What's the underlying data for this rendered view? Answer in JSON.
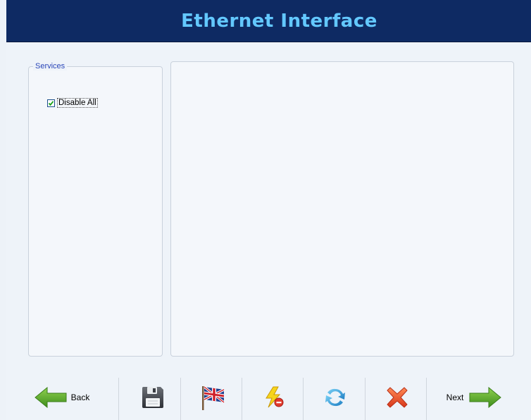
{
  "header": {
    "title": "Ethernet Interface"
  },
  "services": {
    "legend": "Services",
    "disable_all": {
      "label": "Disable All",
      "checked": true
    }
  },
  "toolbar": {
    "back_label": "Back",
    "next_label": "Next",
    "icons": [
      "back-arrow-icon",
      "save-icon",
      "language-flag-icon",
      "alert-icon",
      "refresh-icon",
      "cancel-icon",
      "next-arrow-icon"
    ]
  },
  "colors": {
    "header_bg": "#0e2a63",
    "title": "#63c8ff",
    "arrow_green": "#5fae2e",
    "cancel_red": "#e8542a",
    "refresh_blue": "#2f9ad6"
  }
}
